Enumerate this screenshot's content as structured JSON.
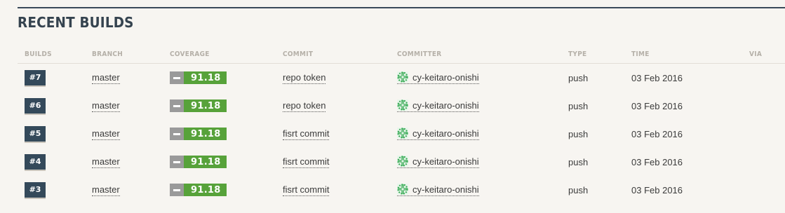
{
  "section": {
    "title": "RECENT BUILDS"
  },
  "columns": [
    "BUILDS",
    "BRANCH",
    "COVERAGE",
    "COMMIT",
    "COMMITTER",
    "TYPE",
    "TIME",
    "VIA"
  ],
  "colors": {
    "badge_bg": "#34495a",
    "coverage_green": "#57a23a",
    "coverage_gray": "#9a9a9a",
    "avatar_green": "#3fae5b"
  },
  "builds": [
    {
      "id": "#7",
      "branch": "master",
      "coverage": "91.18",
      "coverage_change_icon": "minus-icon",
      "commit": "repo token",
      "committer": "cy-keitaro-onishi",
      "type": "push",
      "time": "03 Feb 2016",
      "via": ""
    },
    {
      "id": "#6",
      "branch": "master",
      "coverage": "91.18",
      "coverage_change_icon": "minus-icon",
      "commit": "repo token",
      "committer": "cy-keitaro-onishi",
      "type": "push",
      "time": "03 Feb 2016",
      "via": ""
    },
    {
      "id": "#5",
      "branch": "master",
      "coverage": "91.18",
      "coverage_change_icon": "minus-icon",
      "commit": "fisrt commit",
      "committer": "cy-keitaro-onishi",
      "type": "push",
      "time": "03 Feb 2016",
      "via": ""
    },
    {
      "id": "#4",
      "branch": "master",
      "coverage": "91.18",
      "coverage_change_icon": "minus-icon",
      "commit": "fisrt commit",
      "committer": "cy-keitaro-onishi",
      "type": "push",
      "time": "03 Feb 2016",
      "via": ""
    },
    {
      "id": "#3",
      "branch": "master",
      "coverage": "91.18",
      "coverage_change_icon": "minus-icon",
      "commit": "fisrt commit",
      "committer": "cy-keitaro-onishi",
      "type": "push",
      "time": "03 Feb 2016",
      "via": ""
    }
  ]
}
